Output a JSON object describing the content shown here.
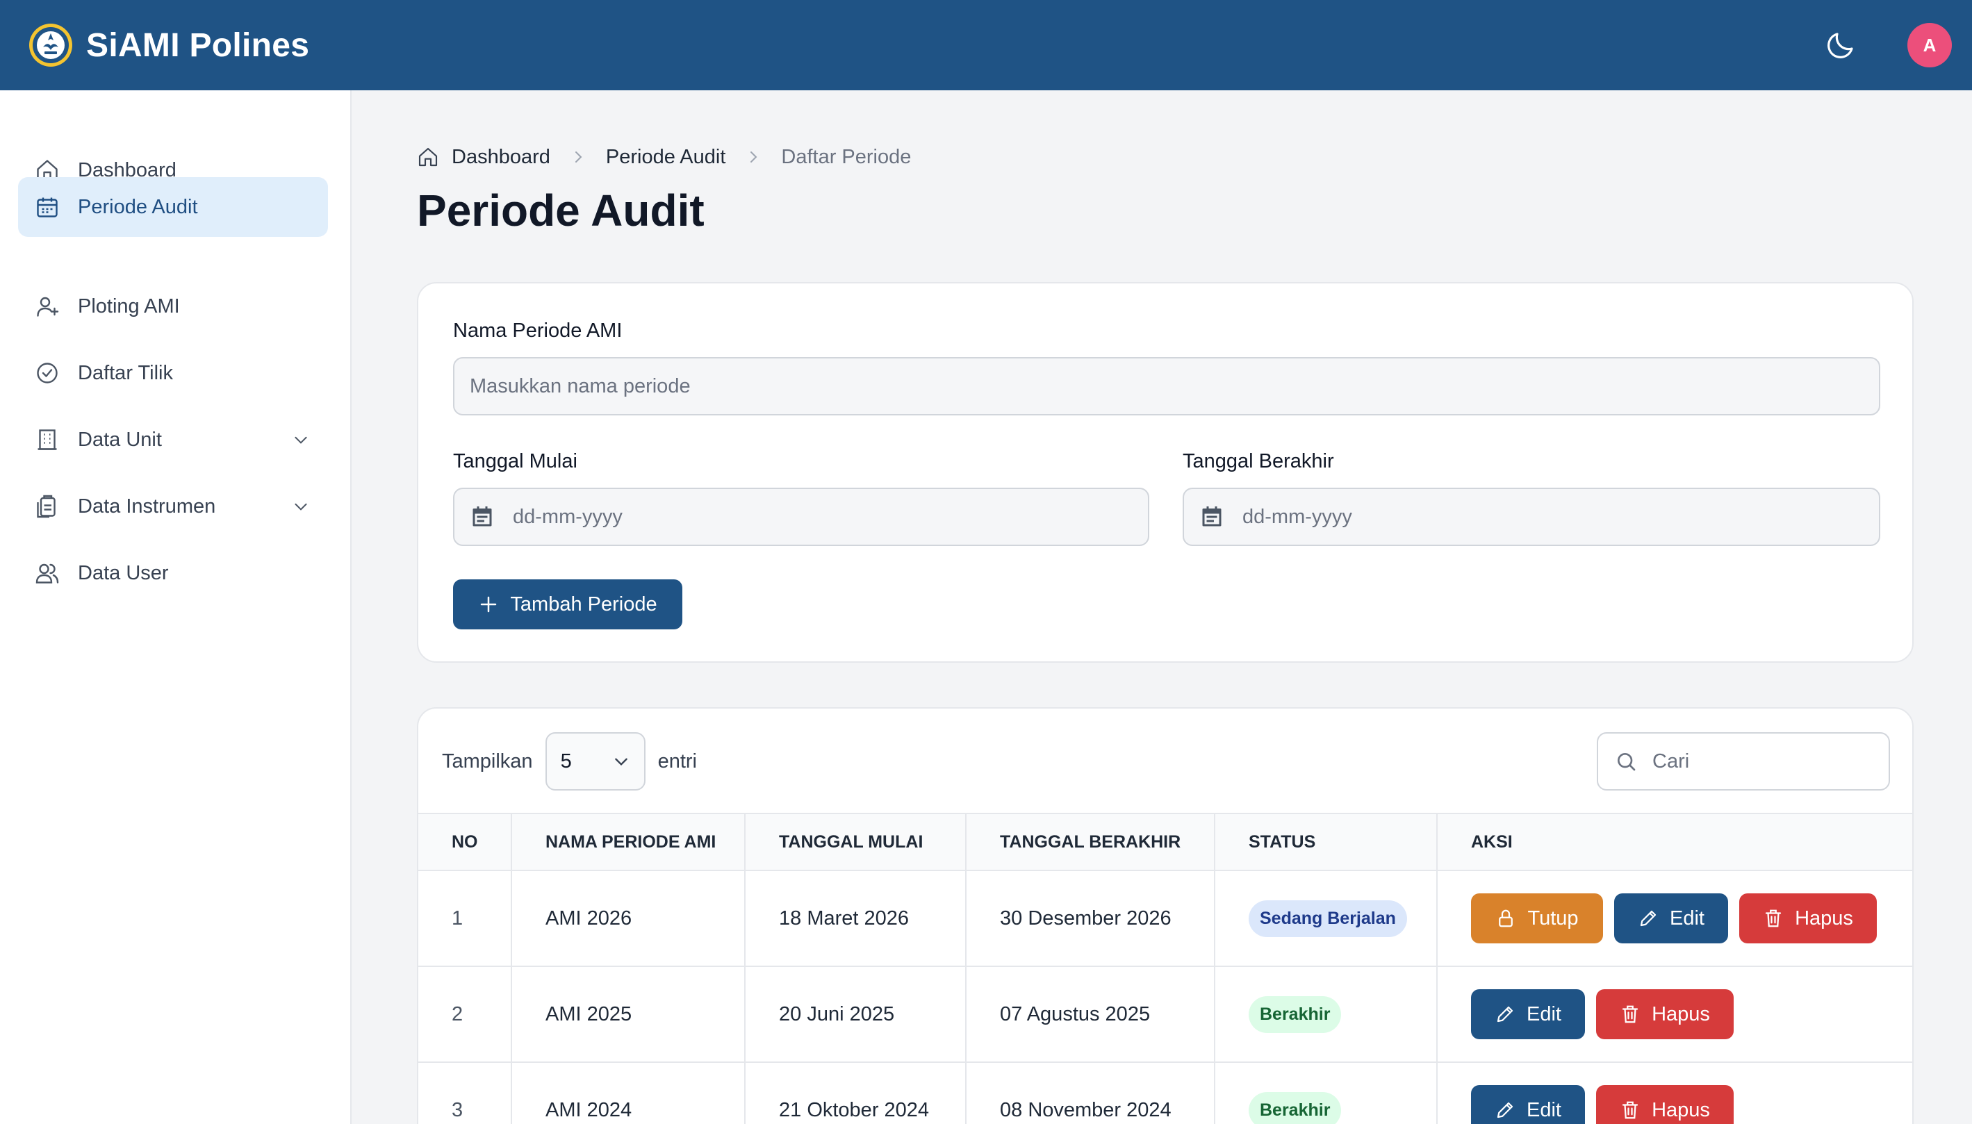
{
  "app": {
    "title": "SiAMI Polines",
    "avatar_initial": "A"
  },
  "colors": {
    "header": "#1f5385",
    "accent": "#1f5385",
    "active_nav_bg": "#e0eefb",
    "warning": "#d9822b",
    "danger": "#d63b3b"
  },
  "sidebar": {
    "items": [
      {
        "label": "Dashboard",
        "icon": "home-icon"
      },
      {
        "label": "Periode Audit",
        "icon": "calendar-icon",
        "active": true
      },
      {
        "label": "Ploting AMI",
        "icon": "user-plus-icon"
      },
      {
        "label": "Daftar Tilik",
        "icon": "check-circle-icon"
      },
      {
        "label": "Data Unit",
        "icon": "building-icon",
        "expandable": true
      },
      {
        "label": "Data Instrumen",
        "icon": "clipboard-icon",
        "expandable": true
      },
      {
        "label": "Data User",
        "icon": "users-icon"
      }
    ]
  },
  "breadcrumb": {
    "items": [
      "Dashboard",
      "Periode Audit",
      "Daftar Periode"
    ]
  },
  "page": {
    "title": "Periode Audit"
  },
  "form": {
    "name_label": "Nama Periode AMI",
    "name_placeholder": "Masukkan nama periode",
    "start_label": "Tanggal Mulai",
    "start_placeholder": "dd-mm-yyyy",
    "end_label": "Tanggal Berakhir",
    "end_placeholder": "dd-mm-yyyy",
    "submit_label": "Tambah Periode"
  },
  "table_controls": {
    "show_label": "Tampilkan",
    "page_size": "5",
    "entries_label": "entri",
    "search_placeholder": "Cari"
  },
  "table": {
    "headers": [
      "NO",
      "NAMA PERIODE AMI",
      "TANGGAL MULAI",
      "TANGGAL BERAKHIR",
      "STATUS",
      "AKSI"
    ],
    "rows": [
      {
        "no": "1",
        "name": "AMI 2026",
        "start": "18 Maret 2026",
        "end": "30 Desember 2026",
        "status": "Sedang Berjalan"
      },
      {
        "no": "2",
        "name": "AMI 2025",
        "start": "20 Juni 2025",
        "end": "07 Agustus 2025",
        "status": "Berakhir"
      },
      {
        "no": "3",
        "name": "AMI 2024",
        "start": "21 Oktober 2024",
        "end": "08 November 2024",
        "status": "Berakhir"
      }
    ],
    "actions": {
      "close": "Tutup",
      "edit": "Edit",
      "delete": "Hapus"
    }
  }
}
